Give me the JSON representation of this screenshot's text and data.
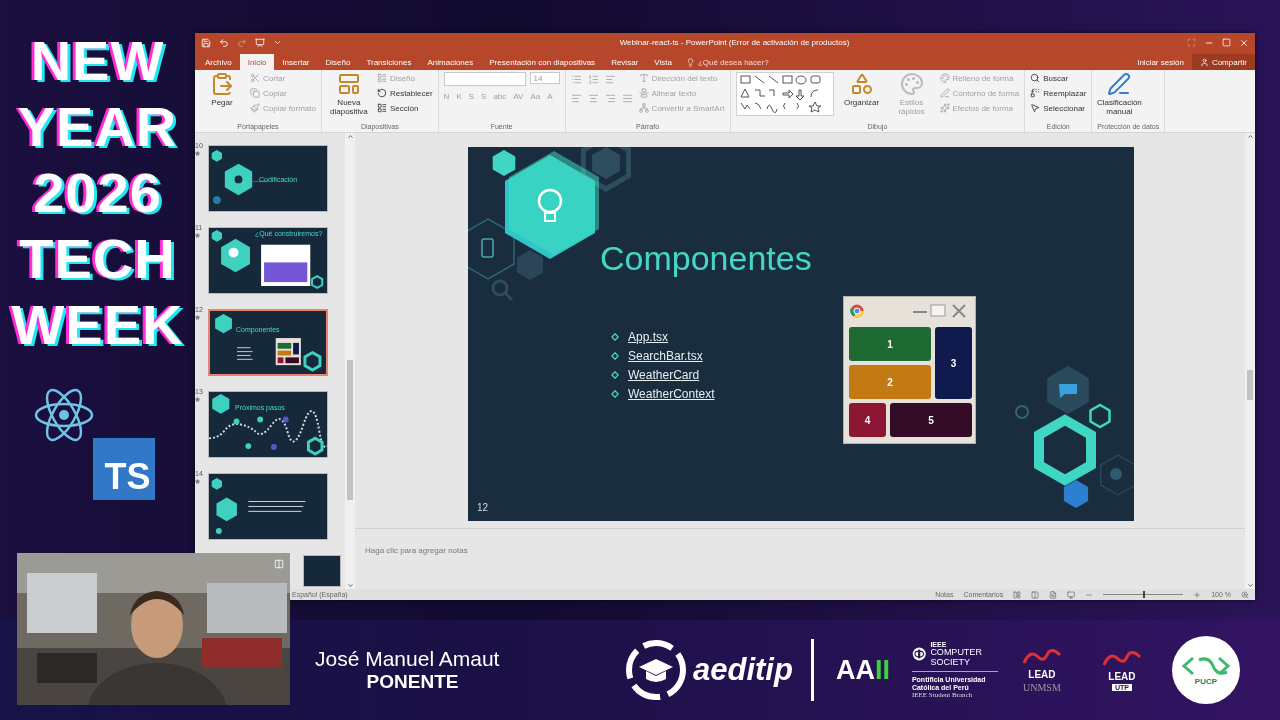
{
  "stream_title": {
    "lines": [
      "NEW",
      "YEAR",
      "2026",
      "TECH",
      "WEEK"
    ]
  },
  "ts_badge": "TS",
  "window": {
    "title": "Webinar-react-ts - PowerPoint (Error de activación de productos)"
  },
  "tabs": [
    {
      "label": "Archivo",
      "selected": false
    },
    {
      "label": "Inicio",
      "selected": true
    },
    {
      "label": "Insertar",
      "selected": false
    },
    {
      "label": "Diseño",
      "selected": false
    },
    {
      "label": "Transiciones",
      "selected": false
    },
    {
      "label": "Animaciones",
      "selected": false
    },
    {
      "label": "Presentación con diapositivas",
      "selected": false
    },
    {
      "label": "Revisar",
      "selected": false
    },
    {
      "label": "Vista",
      "selected": false
    }
  ],
  "tell_me": {
    "placeholder": "¿Qué desea hacer?"
  },
  "account": {
    "sign_in": "Iniciar sesión",
    "share": "Compartir"
  },
  "ribbon": {
    "groups": [
      {
        "label": "Portapapeles",
        "items": [
          {
            "kind": "large",
            "label": "Pegar",
            "disabled": false
          },
          {
            "kind": "stack",
            "entries": [
              {
                "label": "Cortar",
                "disabled": true
              },
              {
                "label": "Copiar",
                "disabled": true
              },
              {
                "label": "Copiar formato",
                "disabled": true
              }
            ]
          }
        ]
      },
      {
        "label": "Diapositivas",
        "items": [
          {
            "kind": "large",
            "label": "Nueva diapositiva",
            "disabled": false
          },
          {
            "kind": "stack",
            "entries": [
              {
                "label": "Diseño",
                "disabled": true
              },
              {
                "label": "Restablecer",
                "disabled": false
              },
              {
                "label": "Sección",
                "disabled": false
              }
            ]
          }
        ]
      },
      {
        "label": "Fuente",
        "items": [
          {
            "kind": "font",
            "size": "14",
            "buttons": [
              "N",
              "K",
              "S",
              "S",
              "abc",
              "AV",
              "Aa",
              "A"
            ]
          }
        ]
      },
      {
        "label": "Párrafo",
        "items": [
          {
            "kind": "paragraph"
          },
          {
            "kind": "stack",
            "entries": [
              {
                "label": "Dirección del texto",
                "disabled": true
              },
              {
                "label": "Alinear texto",
                "disabled": true
              },
              {
                "label": "Convertir a SmartArt",
                "disabled": true
              }
            ]
          }
        ]
      },
      {
        "label": "Dibujo",
        "items": [
          {
            "kind": "shapes"
          },
          {
            "kind": "large",
            "label": "Organizar",
            "disabled": false
          },
          {
            "kind": "large",
            "label": "Estilos rápidos",
            "disabled": true
          },
          {
            "kind": "stack",
            "entries": [
              {
                "label": "Relleno de forma",
                "disabled": true
              },
              {
                "label": "Contorno de forma",
                "disabled": true
              },
              {
                "label": "Efectos de forma",
                "disabled": true
              }
            ]
          }
        ]
      },
      {
        "label": "Edición",
        "items": [
          {
            "kind": "stack",
            "entries": [
              {
                "label": "Buscar",
                "disabled": false
              },
              {
                "label": "Reemplazar",
                "disabled": false
              },
              {
                "label": "Seleccionar",
                "disabled": false
              }
            ]
          }
        ]
      },
      {
        "label": "Protección de datos",
        "items": [
          {
            "kind": "large",
            "label": "Clasificación manual",
            "disabled": false
          }
        ]
      }
    ]
  },
  "slides": [
    {
      "number": "10",
      "kind": "title",
      "title": "Codificación",
      "selected": false
    },
    {
      "number": "11",
      "title": "¿Qué construiremos?",
      "selected": false
    },
    {
      "number": "12",
      "kind": "list",
      "title": "Componentes",
      "selected": true
    },
    {
      "number": "13",
      "kind": "path",
      "title": "Próximos pasos",
      "selected": false
    },
    {
      "number": "14",
      "kind": "text",
      "selected": false
    },
    {
      "kind": "blank",
      "selected": false
    }
  ],
  "slide": {
    "title": "Componentes",
    "bullets": [
      "App.tsx",
      "SearchBar.tsx",
      "WeatherCard",
      "WeatherContext"
    ],
    "mockup": {
      "cells": [
        {
          "label": "1",
          "color": "#1f6a33"
        },
        {
          "label": "3",
          "color": "#101a4c"
        },
        {
          "label": "2",
          "color": "#c47a14"
        },
        {
          "label": "4",
          "color": "#8c1634"
        },
        {
          "label": "5",
          "color": "#330b24"
        }
      ]
    },
    "number": "12"
  },
  "notes": {
    "placeholder": "Haga clic para agregar notas"
  },
  "status_bar": {
    "language": "Español (España)",
    "notes": "Notas",
    "comments": "Comentarios",
    "zoom": "100 %",
    "zoom_slider": {
      "level": 0.5
    }
  },
  "banner": {
    "speaker": "José Manuel Amaut",
    "role": "PONENTE",
    "aeditip": "aeditip",
    "aaii_a": "AA",
    "aaii_b": "II",
    "ieee": "IEEE",
    "computer_society": "COMPUTER SOCIETY",
    "university": "Pontificia Universidad Católica del Perú",
    "branch": "IEEE Student Branch",
    "lead_1": "LEAD",
    "unmsm": "UNMSM",
    "lead_2": "LEAD",
    "utp": "UTP",
    "pucp": "PUCP"
  }
}
